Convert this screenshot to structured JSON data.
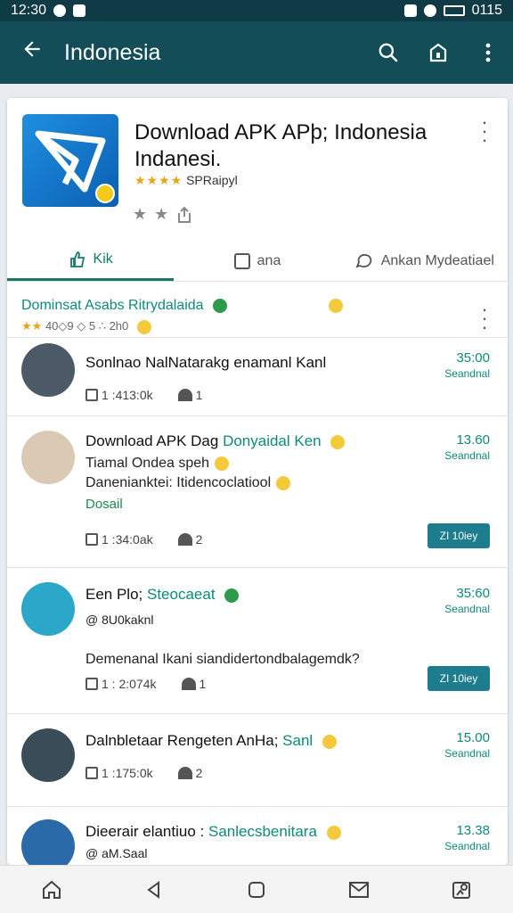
{
  "status": {
    "time": "12:30",
    "right_text": "0115"
  },
  "appbar": {
    "title": "Indonesia",
    "icons": [
      "arrow-left-icon",
      "search-icon",
      "bag-icon",
      "more-vert-icon"
    ]
  },
  "app": {
    "title": "Download APK APþ; Indonesia Indanesi.",
    "rating_text": "SPRaipyl",
    "sub_icons": [
      "star-icon",
      "star-icon",
      "share-icon"
    ]
  },
  "tabs": [
    {
      "label": "Kik",
      "active": true
    },
    {
      "label": "ana",
      "active": false
    },
    {
      "label": "Ankan Mydeatiael",
      "active": false
    }
  ],
  "feed": {
    "title": "Dominsat Asabs Ritrydalaida",
    "meta": "40◇9 ◇ 5 ∴ 2h0"
  },
  "items": [
    {
      "title": "Sonlnao NalNatarakg enamanl Kanl",
      "title_accent": "",
      "lines": [],
      "green": "",
      "views": "1 :413:0k",
      "likes": "1",
      "time": "35:00",
      "tag": "Seandnal",
      "pill": ""
    },
    {
      "title": "Download APK Dag",
      "title_accent": "Donyaidal Ken",
      "lines": [
        "Tiamal Ondea speh",
        "Danenianktei: Itidencoclatiool"
      ],
      "green": "Dosail",
      "views": "1 :34:0ak",
      "likes": "2",
      "time": "13.60",
      "tag": "Seandnal",
      "pill": "ZI 10iey"
    },
    {
      "title": "Een Plo;",
      "title_accent": "Steocaeat",
      "lines": [
        "@ 8U0kaknl",
        "Demenanal Ikani siandidertondbalagemdk?"
      ],
      "green": "",
      "views": "1 : 2:074k",
      "likes": "1",
      "time": "35:60",
      "tag": "Seandnal",
      "pill": "ZI 10iey"
    },
    {
      "title": "Dalnbletaar Rengeten AnHa;",
      "title_accent": "Sanl",
      "lines": [],
      "green": "",
      "views": "1 :175:0k",
      "likes": "2",
      "time": "15.00",
      "tag": "Seandnal",
      "pill": ""
    },
    {
      "title": "Dieerair elantiuo :",
      "title_accent": "Sanlecsbenitara",
      "lines": [
        "@ aM.Saal"
      ],
      "green": "",
      "views": "",
      "likes": "",
      "time": "13.38",
      "tag": "Seandnal",
      "pill": ""
    }
  ],
  "navbar": [
    "home-icon",
    "back-icon",
    "recents-icon",
    "mail-icon",
    "profile-icon"
  ],
  "colors": {
    "appbar": "#134d57",
    "statusbar": "#0e3b45",
    "accent": "#0d8a79",
    "pill": "#1e7c8f"
  }
}
